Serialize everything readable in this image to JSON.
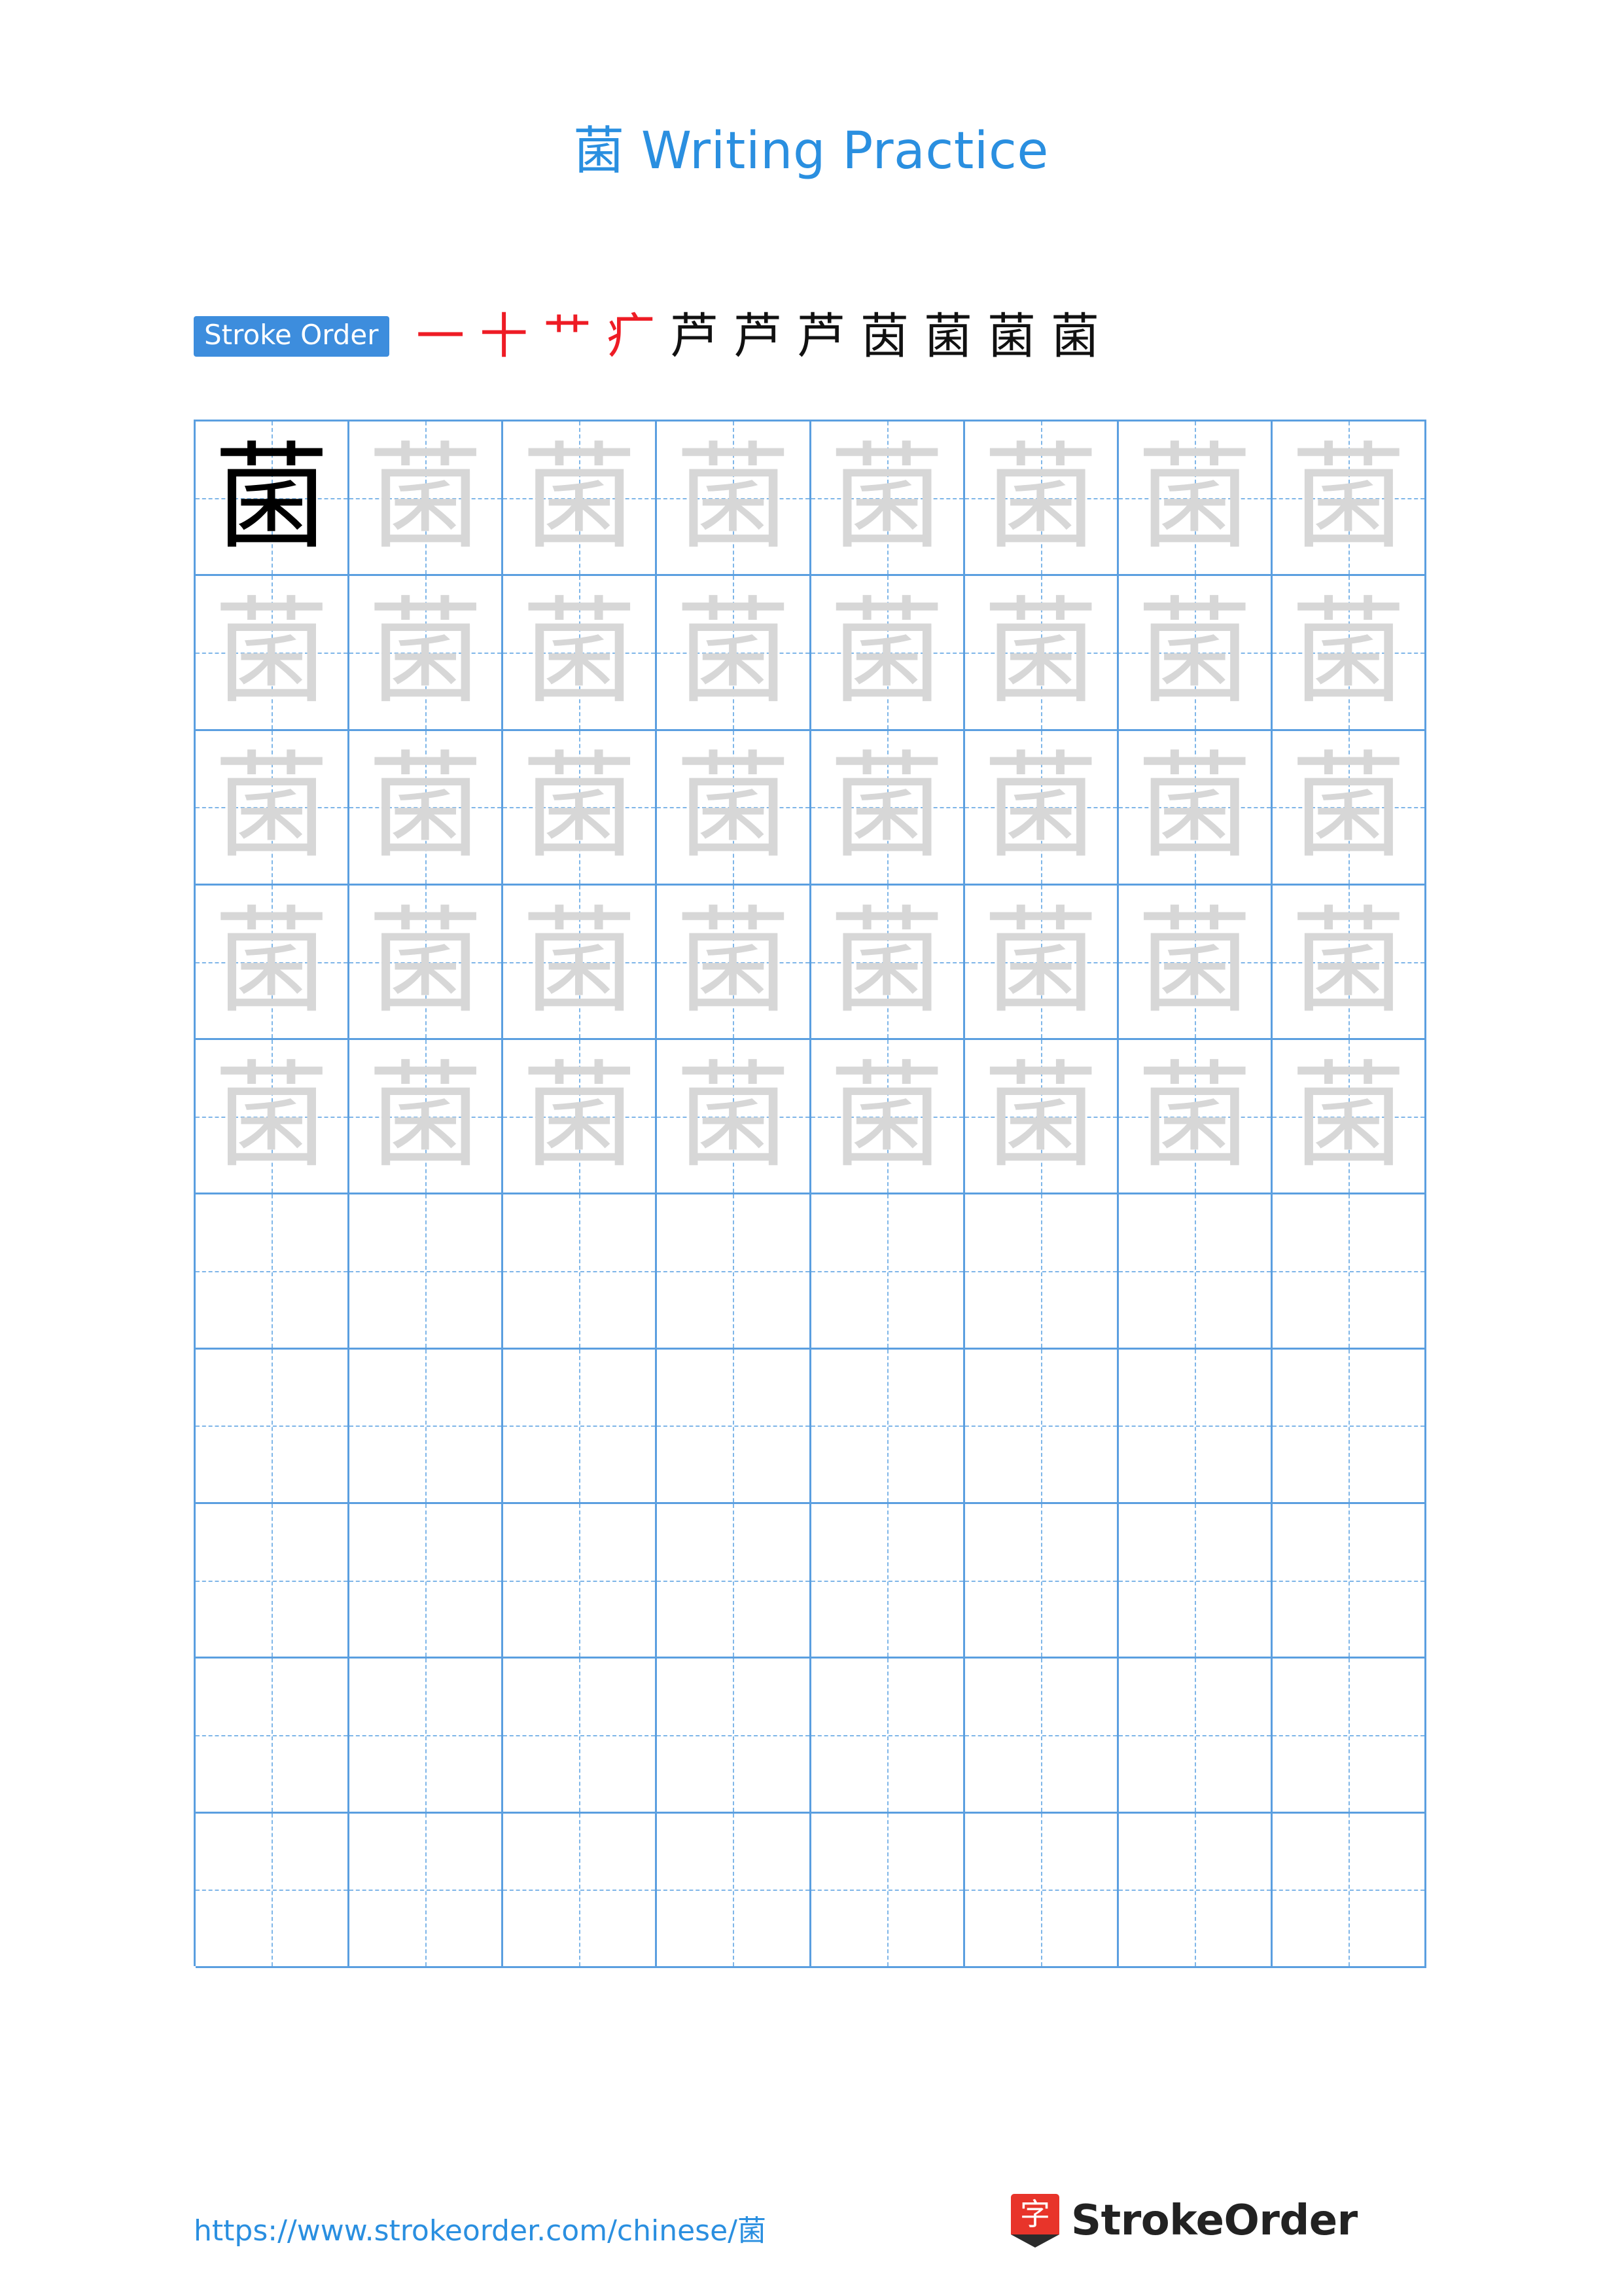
{
  "document": {
    "title": "菌 Writing Practice",
    "character": "菌"
  },
  "stroke_order": {
    "badge_label": "Stroke Order",
    "steps": [
      {
        "glyph": "一",
        "color": "#ee1c25"
      },
      {
        "glyph": "十",
        "color": "#ee1c25"
      },
      {
        "glyph": "艹",
        "color": "#ee1c25"
      },
      {
        "glyph": "疒",
        "color": "#ee1c25"
      },
      {
        "glyph": "芦",
        "color": "#111111"
      },
      {
        "glyph": "芦",
        "color": "#111111"
      },
      {
        "glyph": "芦",
        "color": "#111111"
      },
      {
        "glyph": "茵",
        "color": "#111111"
      },
      {
        "glyph": "菌",
        "color": "#111111"
      },
      {
        "glyph": "菌",
        "color": "#111111"
      },
      {
        "glyph": "菌",
        "color": "#111111"
      }
    ]
  },
  "practice_grid": {
    "columns": 8,
    "rows": 10,
    "traced_rows": 5,
    "solid_cell": {
      "row": 0,
      "column": 0,
      "glyph": "菌"
    },
    "ghost_glyph": "菌",
    "grid_line_color": "#5b9fe0",
    "guide_line_color": "#7fb6e8",
    "ghost_color": "#d7d7d7"
  },
  "footer": {
    "url": "https://www.strokeorder.com/chinese/菌",
    "brand_mark": "字",
    "brand_name": "StrokeOrder"
  },
  "colors": {
    "accent": "#2a8fe0",
    "badge": "#3d8ddd",
    "red": "#ee1c25",
    "brand_red": "#e8342a"
  }
}
